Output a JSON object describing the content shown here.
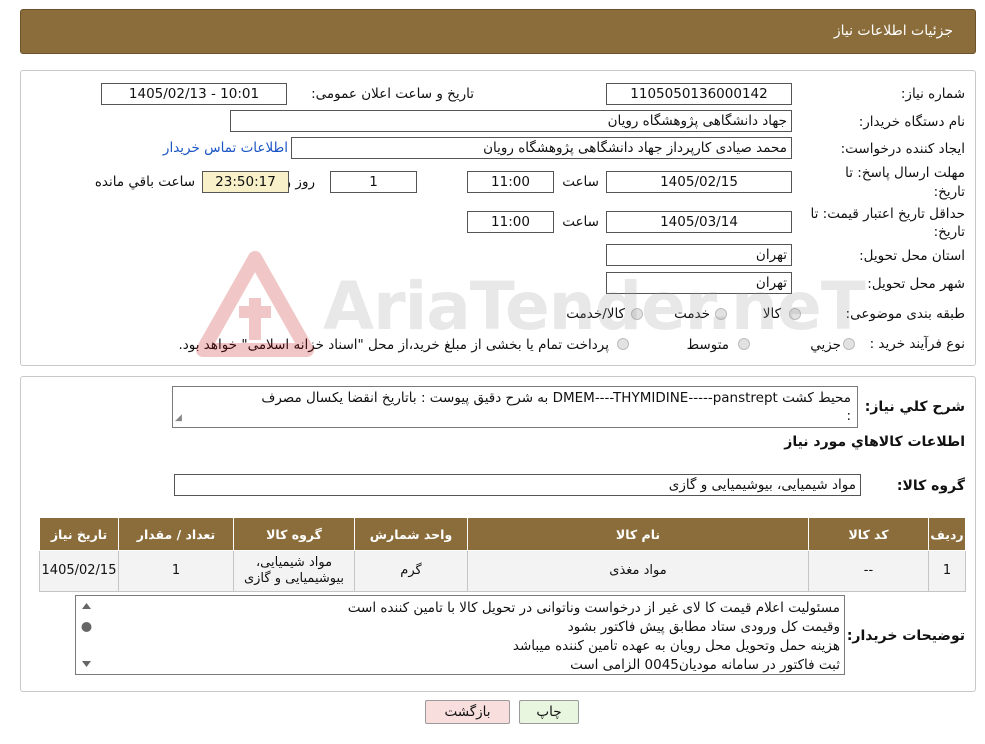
{
  "header": {
    "title": "جزئیات اطلاعات نیاز"
  },
  "form": {
    "need_number_label": "شماره نیاز:",
    "need_number": "1105050136000142",
    "announce_label": "تاریخ و ساعت اعلان عمومی:",
    "announce_value": "1405/02/13 - 10:01",
    "buyer_org_label": "نام دستگاه خریدار:",
    "buyer_org": "جهاد دانشگاهی پژوهشگاه رویان",
    "creator_label": "ایجاد کننده درخواست:",
    "creator": "محمد صیادی کارپرداز جهاد دانشگاهی پژوهشگاه رویان",
    "contact_link": "اطلاعات تماس خریدار",
    "deadline_label_1": "مهلت ارسال پاسخ: تا",
    "deadline_label_2": "تاریخ:",
    "deadline_date": "1405/02/15",
    "time_label": "ساعت",
    "deadline_time": "11:00",
    "days_value": "1",
    "days_label": "روز و",
    "remaining_time": "23:50:17",
    "remaining_label": "ساعت باقي مانده",
    "validity_label_1": "حداقل تاریخ اعتبار قیمت: تا",
    "validity_label_2": "تاریخ:",
    "validity_date": "1405/03/14",
    "validity_time_label": "ساعت",
    "validity_time": "11:00",
    "province_label": "استان محل تحویل:",
    "province": "تهران",
    "city_label": "شهر محل تحویل:",
    "city": "تهران",
    "category_label": "طبقه بندی موضوعی:",
    "category_options": [
      "کالا",
      "خدمت",
      "کالا/خدمت"
    ],
    "purchase_type_label": "نوع فرآیند خرید :",
    "purchase_options": [
      "جزيي",
      "متوسط"
    ],
    "purchase_note": "پرداخت تمام یا بخشی از مبلغ خرید،از محل \"اسناد خزانه اسلامی\" خواهد بود."
  },
  "summary": {
    "label": "شرح کلي نياز:",
    "text_line1": "محیط کشت       DMEM----THYMIDINE-----panstrept به شرح دقیق پیوست : باتاریخ انقضا یکسال مصرف",
    "text_line2": ":"
  },
  "goods": {
    "section_title": "اطلاعات کالاهاي مورد نياز",
    "group_label": "گروه کالا:",
    "group_value": "مواد شیمیایی، بیوشیمیایی و  گازی"
  },
  "table": {
    "headers": [
      "رديف",
      "کد کالا",
      "نام کالا",
      "واحد شمارش",
      "گروه کالا",
      "تعداد / مقدار",
      "تاريخ نياز"
    ],
    "rows": [
      {
        "row": "1",
        "code": "--",
        "name": "مواد مغذی",
        "unit": "گرم",
        "group_line1": "مواد شیمیایی،",
        "group_line2": "بیوشیمیایی و گازی",
        "qty": "1",
        "date": "1405/02/15"
      }
    ]
  },
  "buyer_notes": {
    "label": "توضیحات خریدار:",
    "lines": [
      "مسئولیت اعلام قیمت کا لای  غیر از درخواست وناتوانی در تحویل کالا با تامین کننده است",
      "وقیمت کل ورودی ستاد مطابق پیش فاکتور بشود",
      "هزینه حمل وتحویل محل رویان به عهده تامین کننده میباشد",
      "ثبت فاکتور در سامانه مودیان0045 الزامی است"
    ]
  },
  "buttons": {
    "print": "چاپ",
    "back": "بازگشت"
  },
  "watermark": {
    "text": "AriaTender.neT"
  },
  "colors": {
    "header_brown": "#8b6d3b",
    "link_blue": "#1a55c4",
    "back_button_pink": "#f9dede",
    "print_button_green": "#e8f6df",
    "remaining_yellow": "#f7f0c8"
  }
}
